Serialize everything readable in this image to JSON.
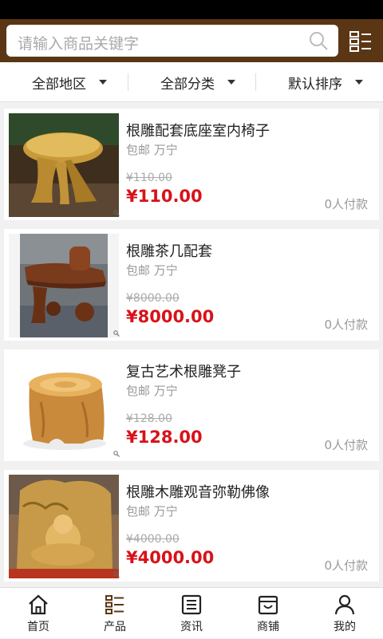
{
  "search": {
    "placeholder": "请输入商品关键字",
    "icon": "search-icon",
    "menu_icon": "list-menu-icon"
  },
  "filters": [
    {
      "label": "全部地区"
    },
    {
      "label": "全部分类"
    },
    {
      "label": "默认排序"
    }
  ],
  "products": [
    {
      "name": "根雕配套底座室内椅子",
      "meta": "包邮 万宁",
      "old_price": "¥110.00",
      "price": "¥110.00",
      "paid": "0人付款",
      "image": "wooden-root-table-photo"
    },
    {
      "name": "根雕茶几配套",
      "meta": "包邮 万宁",
      "old_price": "¥8000.00",
      "price": "¥8000.00",
      "paid": "0人付款",
      "image": "root-tea-table-photo"
    },
    {
      "name": "复古艺术根雕凳子",
      "meta": "包邮 万宁",
      "old_price": "¥128.00",
      "price": "¥128.00",
      "paid": "0人付款",
      "image": "root-stool-photo"
    },
    {
      "name": "根雕木雕观音弥勒佛像",
      "meta": "包邮 万宁",
      "old_price": "¥4000.00",
      "price": "¥4000.00",
      "paid": "0人付款",
      "image": "buddha-carving-photo"
    }
  ],
  "tabs": [
    {
      "label": "首页",
      "icon": "home-icon"
    },
    {
      "label": "产品",
      "icon": "product-list-icon"
    },
    {
      "label": "资讯",
      "icon": "news-icon"
    },
    {
      "label": "商铺",
      "icon": "shop-icon"
    },
    {
      "label": "我的",
      "icon": "user-icon"
    }
  ],
  "colors": {
    "header": "#5b3614",
    "price": "#d8121a"
  }
}
